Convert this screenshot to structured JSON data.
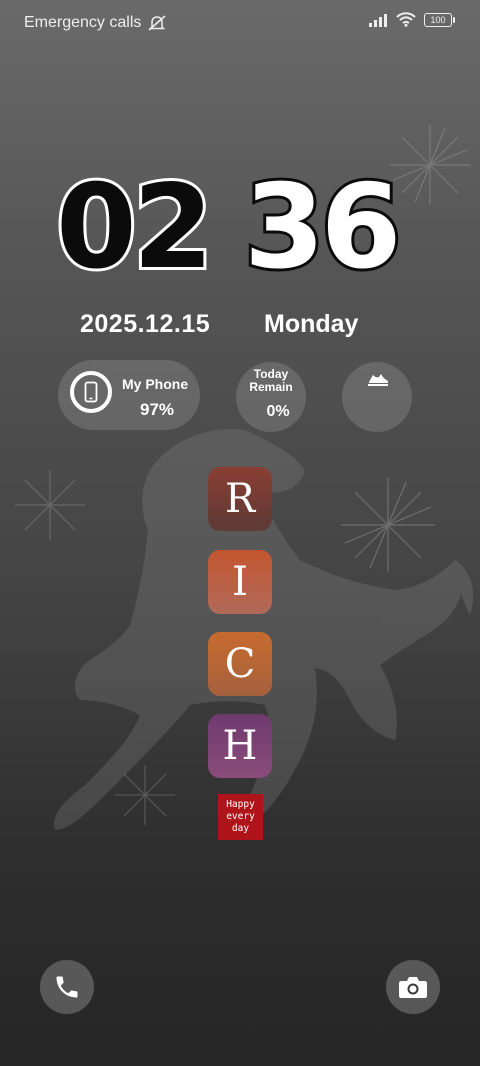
{
  "status_bar": {
    "carrier_text": "Emergency calls",
    "mute_icon": "bell-off-icon",
    "signal_icon": "signal-icon",
    "wifi_icon": "wifi-icon",
    "battery_level": "100"
  },
  "clock": {
    "hours": "02",
    "minutes": "36",
    "date": "2025.12.15",
    "weekday": "Monday"
  },
  "widgets": {
    "phone": {
      "label": "My Phone",
      "value": "97%",
      "icon": "smartphone-icon"
    },
    "remain": {
      "label_line1": "Today",
      "label_line2": "Remain",
      "value": "0%"
    },
    "steps": {
      "icon": "sneaker-icon"
    }
  },
  "tiles": {
    "r": "R",
    "i": "I",
    "c": "C",
    "h": "H"
  },
  "sticker": {
    "line1": "Happy",
    "line2": "every",
    "line3": "day"
  },
  "shortcuts": {
    "left_icon": "phone-icon",
    "right_icon": "camera-icon"
  },
  "colors": {
    "tile_r": "#7a3a32",
    "tile_i": "#c4552f",
    "tile_c": "#c76b2f",
    "tile_h": "#6d3a6e",
    "sticker": "#b0141b"
  }
}
